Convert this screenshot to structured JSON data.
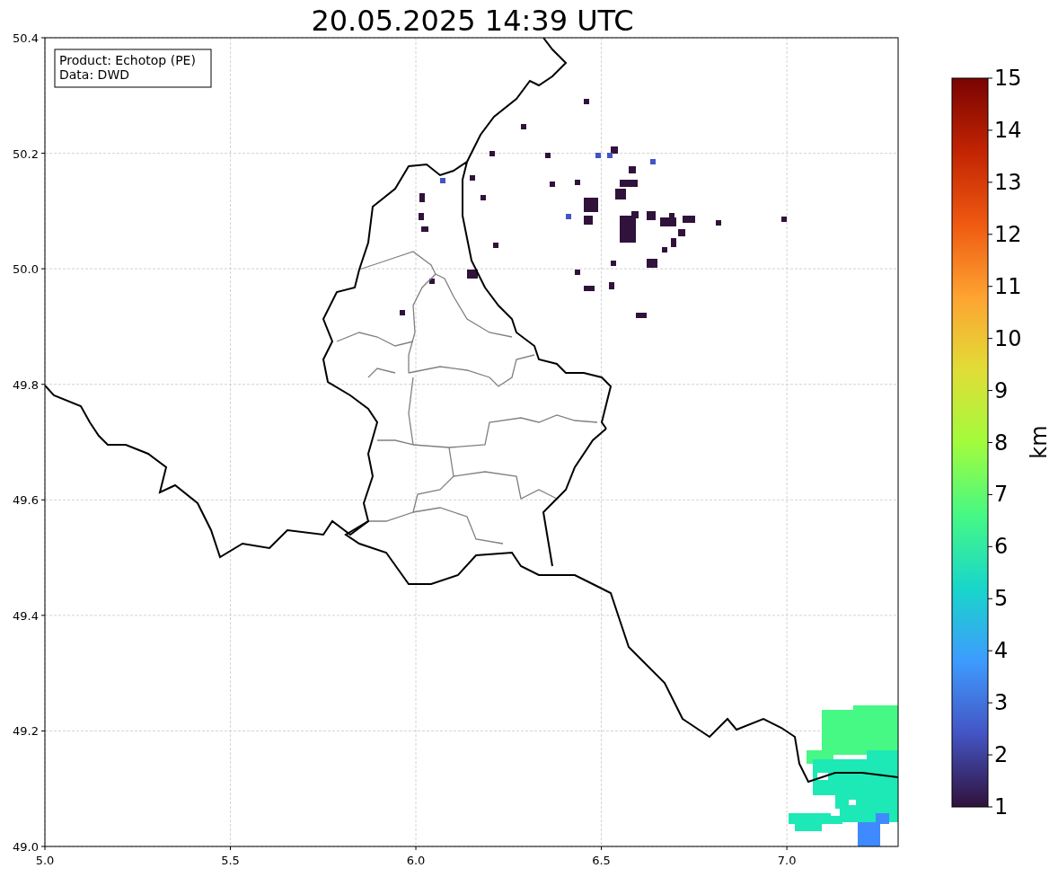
{
  "title": "20.05.2025 14:39 UTC",
  "map": {
    "info_box": [
      "Product: Echotop (PE)",
      "Data: DWD"
    ],
    "xticks": [
      "5.0",
      "5.5",
      "6.0",
      "6.5",
      "7.0"
    ],
    "yticks": [
      "50.4",
      "50.2",
      "50.0",
      "49.8",
      "49.6",
      "49.4",
      "49.2",
      "49.0"
    ]
  },
  "colorbar": {
    "label": "km",
    "ticks": [
      "15",
      "14",
      "13",
      "12",
      "11",
      "10",
      "9",
      "8",
      "7",
      "6",
      "5",
      "4",
      "3",
      "2",
      "1"
    ]
  }
}
